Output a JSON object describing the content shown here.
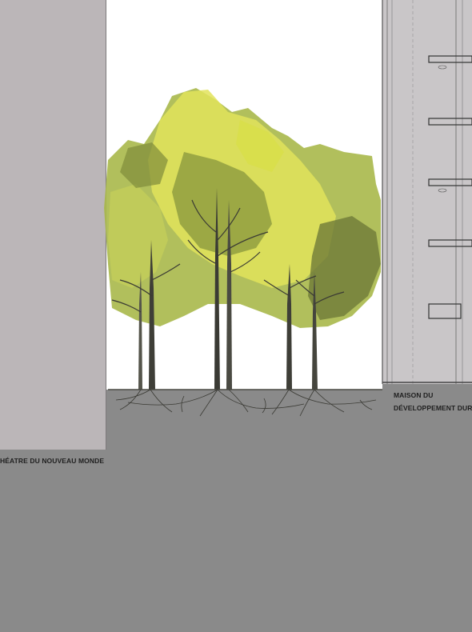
{
  "labels": {
    "theatre": "HÉATRE DU NOUVEAU MONDE",
    "maison_line1": "MAISON DU",
    "maison_line2": "DÉVELOPPEMENT DURA"
  },
  "colors": {
    "ground": "#8a8a8a",
    "theatre_wall": "#bbb6b8",
    "building": "#c9c6c8",
    "foliage_yellow": "#e2e35a",
    "foliage_green": "#a8b84a",
    "foliage_dark": "#6f7a38",
    "trunk": "#3a3a34"
  },
  "icons": [
    "tree-icon",
    "roots-icon",
    "building-section-icon"
  ]
}
